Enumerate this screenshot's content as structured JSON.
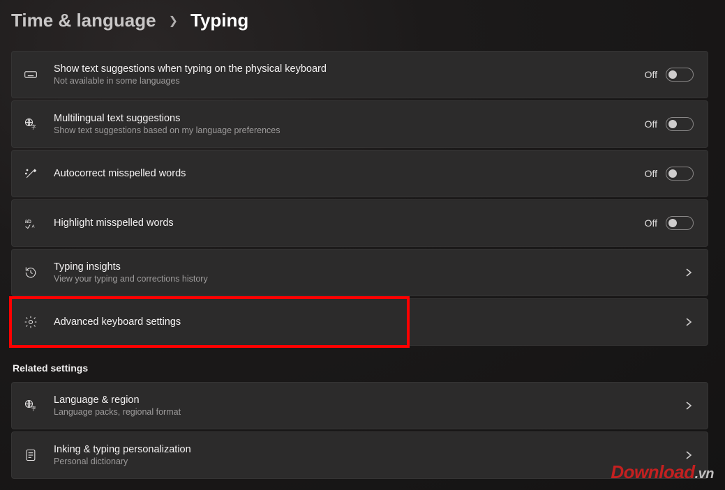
{
  "breadcrumb": {
    "parent": "Time & language",
    "current": "Typing"
  },
  "settings": [
    {
      "icon": "keyboard",
      "title": "Show text suggestions when typing on the physical keyboard",
      "sub": "Not available in some languages",
      "state": "Off",
      "control": "toggle"
    },
    {
      "icon": "globe-text",
      "title": "Multilingual text suggestions",
      "sub": "Show text suggestions based on my language preferences",
      "state": "Off",
      "control": "toggle"
    },
    {
      "icon": "wand",
      "title": "Autocorrect misspelled words",
      "sub": "",
      "state": "Off",
      "control": "toggle"
    },
    {
      "icon": "spellcheck",
      "title": "Highlight misspelled words",
      "sub": "",
      "state": "Off",
      "control": "toggle"
    },
    {
      "icon": "history",
      "title": "Typing insights",
      "sub": "View your typing and corrections history",
      "state": "",
      "control": "nav"
    },
    {
      "icon": "gear",
      "title": "Advanced keyboard settings",
      "sub": "",
      "state": "",
      "control": "nav",
      "highlight": true
    }
  ],
  "related_heading": "Related settings",
  "related": [
    {
      "icon": "globe-text",
      "title": "Language & region",
      "sub": "Language packs, regional format",
      "control": "nav"
    },
    {
      "icon": "document",
      "title": "Inking & typing personalization",
      "sub": "Personal dictionary",
      "control": "nav"
    }
  ],
  "watermark": {
    "main": "Download",
    "suffix": ".vn"
  }
}
